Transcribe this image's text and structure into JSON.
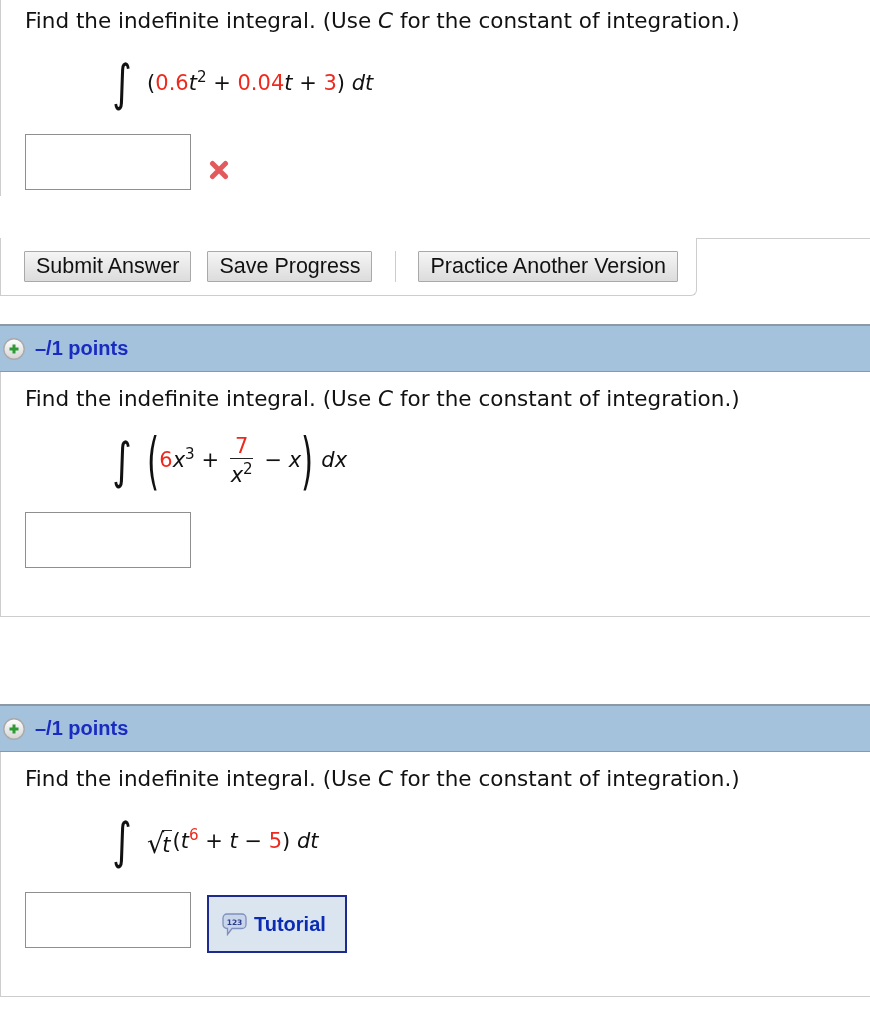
{
  "questions": [
    {
      "prompt": "Find the indefinite integral. (Use *C* for the constant of integration.)",
      "expression": [
        {
          "kind": "sign",
          "text": "∫"
        },
        {
          "kind": "plain",
          "text": "("
        },
        {
          "kind": "given",
          "text": "0.6"
        },
        {
          "kind": "plain",
          "text": "*t*$^{2}$ + "
        },
        {
          "kind": "given",
          "text": "0.04"
        },
        {
          "kind": "plain",
          "text": "*t* + "
        },
        {
          "kind": "given",
          "text": "3"
        },
        {
          "kind": "plain",
          "text": ") "
        },
        {
          "kind": "var",
          "text": "dt"
        }
      ],
      "answer": {
        "incorrect": true
      },
      "actions": [
        "Submit Answer",
        "Save Progress"
      ],
      "practice": "Practice Another Version"
    },
    {
      "points": "–/1 points",
      "prompt": "Find the indefinite integral. (Use *C* for the constant of integration.)",
      "expression": [
        {
          "kind": "sign",
          "text": "∫"
        },
        {
          "kind": "paren",
          "open": "(",
          "close": ")",
          "inner": [
            {
              "kind": "given",
              "text": "6"
            },
            {
              "kind": "plain",
              "text": "*x*$^{3}$ + "
            },
            {
              "kind": "fraction",
              "over": [
                {
                  "kind": "given",
                  "text": "7"
                }
              ],
              "under": [
                {
                  "kind": "plain",
                  "text": "*x*$^{2}$"
                }
              ]
            },
            {
              "kind": "plain",
              "text": " − *x*"
            }
          ]
        },
        {
          "kind": "var",
          "text": "dx"
        }
      ],
      "answer": {
        "incorrect": false
      }
    },
    {
      "points": "–/1 points",
      "prompt": "Find the indefinite integral. (Use *C* for the constant of integration.)",
      "expression": [
        {
          "kind": "sign",
          "text": "∫"
        },
        {
          "kind": "root",
          "sign": "√",
          "under": [
            {
              "kind": "var",
              "text": "t"
            }
          ]
        },
        {
          "kind": "plain",
          "text": "(*t*"
        },
        {
          "kind": "given",
          "text": "$^{6}$"
        },
        {
          "kind": "plain",
          "text": " + *t* − "
        },
        {
          "kind": "given",
          "text": "5"
        },
        {
          "kind": "plain",
          "text": ") "
        },
        {
          "kind": "var",
          "text": "dt"
        }
      ],
      "answer": {
        "incorrect": false
      },
      "tutorial": {
        "icon_text": "123",
        "label": "Tutorial"
      }
    }
  ]
}
